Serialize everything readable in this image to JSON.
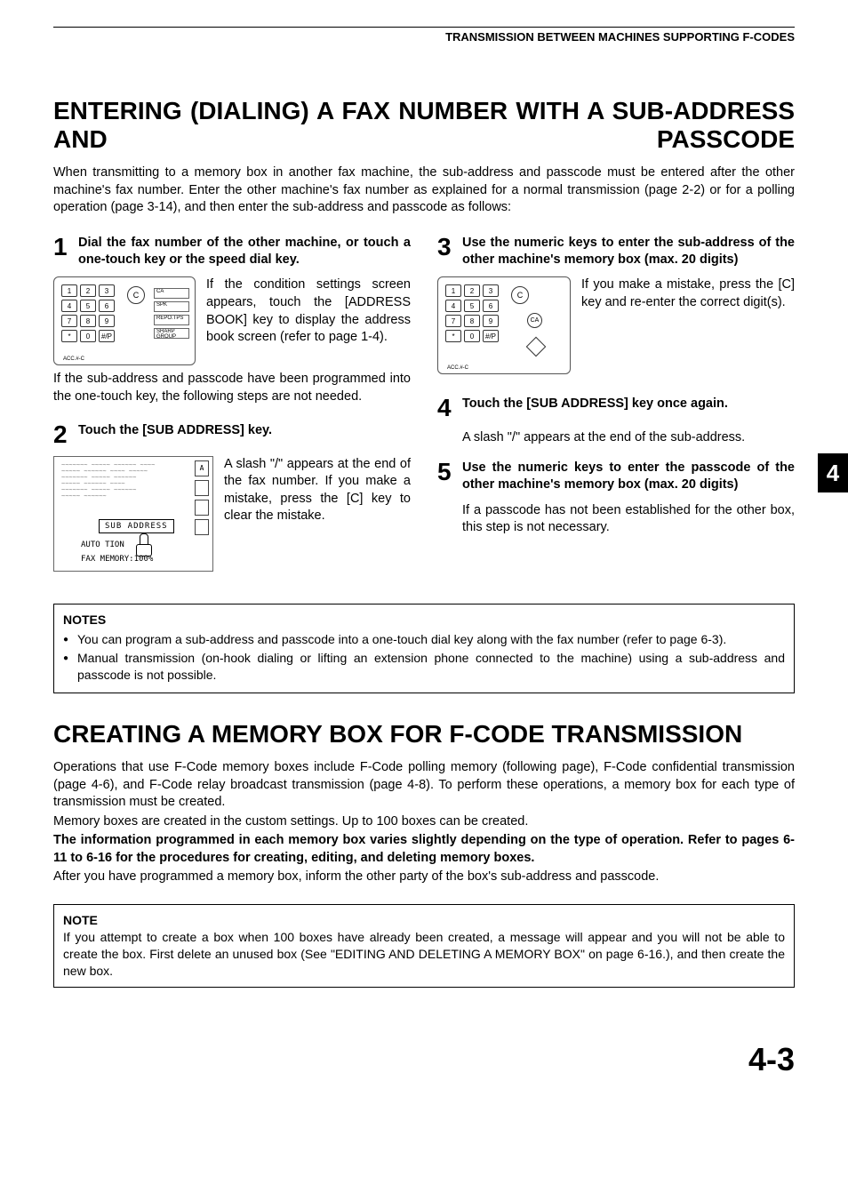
{
  "header": "TRANSMISSION BETWEEN MACHINES SUPPORTING F-CODES",
  "h1a": "ENTERING (DIALING) A FAX NUMBER WITH A SUB-ADDRESS AND PASSCODE",
  "intro1": "When transmitting to a memory box in another fax machine, the sub-address and passcode must be entered after the other machine's fax number. Enter the other machine's fax number as explained for a normal transmission (page 2-2) or for a polling operation (page 3-14), and then enter the sub-address and passcode as follows:",
  "steps": {
    "s1": {
      "num": "1",
      "title": "Dial the fax number of the other machine, or touch a one-touch key or the speed dial key.",
      "body1": "If the condition settings screen appears, touch the [ADDRESS BOOK] key to display the address book screen (refer to page 1-4).",
      "body2": "If the sub-address and passcode have been programmed into the one-touch key, the following steps are not needed."
    },
    "s2": {
      "num": "2",
      "title": "Touch the [SUB ADDRESS] key.",
      "body": "A slash \"/\" appears at the end of the fax number. If you make a mistake, press the [C] key to clear the mistake."
    },
    "s3": {
      "num": "3",
      "title": "Use the numeric keys to enter the sub-address of the other machine's memory box (max. 20 digits)",
      "body": "If you make a mistake, press the [C] key and re-enter the correct digit(s)."
    },
    "s4": {
      "num": "4",
      "title": "Touch the [SUB ADDRESS] key once again.",
      "body": "A slash \"/\" appears at the end of the sub-address."
    },
    "s5": {
      "num": "5",
      "title": "Use the numeric keys to enter the passcode of the other machine's memory box (max. 20 digits)",
      "body": "If a passcode has not been established for the other box, this step is not necessary."
    }
  },
  "fig1": {
    "keys": [
      "1",
      "2",
      "3",
      "4",
      "5",
      "6",
      "7",
      "8",
      "9",
      "*",
      "0",
      "#/P"
    ],
    "c": "C",
    "acc": "ACC.#-C",
    "strips": [
      "CA",
      "SPK",
      "REPO.TPS",
      "SHARP GROUP"
    ]
  },
  "fig2": {
    "btn": "SUB ADDRESS",
    "auto": "AUTO       TION",
    "mem": "FAX MEMORY:100%",
    "side": [
      "A",
      "",
      "",
      "",
      ""
    ]
  },
  "fig3": {
    "keys": [
      "1",
      "2",
      "3",
      "4",
      "5",
      "6",
      "7",
      "8",
      "9",
      "*",
      "0",
      "#/P"
    ],
    "c": "C",
    "ca": "CA",
    "acc": "ACC.#-C"
  },
  "notes1": {
    "title": "NOTES",
    "li1": "You can program a sub-address and passcode into a one-touch dial key along with the fax number (refer to page 6-3).",
    "li2": "Manual transmission (on-hook dialing or lifting an extension phone connected to the machine) using a sub-address and passcode is not possible."
  },
  "h1b": "CREATING A MEMORY BOX FOR F-CODE TRANSMISSION",
  "section2": {
    "p1": "Operations that use F-Code memory boxes include F-Code polling memory (following page), F-Code confidential transmission (page 4-6), and F-Code relay broadcast transmission (page 4-8). To perform these operations, a memory box for each type of transmission must be created.",
    "p2": "Memory boxes are created in the custom settings. Up to 100 boxes can be created.",
    "p3": "The information programmed in each memory box varies slightly depending on the type of operation. Refer to pages 6-11 to 6-16 for the procedures for creating, editing, and deleting memory boxes.",
    "p4": "After you have programmed a memory box, inform the other party of the box's sub-address and passcode."
  },
  "note2": {
    "title": "NOTE",
    "body": "If you attempt to create a box when 100 boxes have already been created, a message will appear and you will not be able to create the box. First delete an unused box (See \"EDITING AND DELETING A MEMORY BOX\" on page 6-16.), and then create the new box."
  },
  "chapterTab": "4",
  "pageNum": "4-3"
}
